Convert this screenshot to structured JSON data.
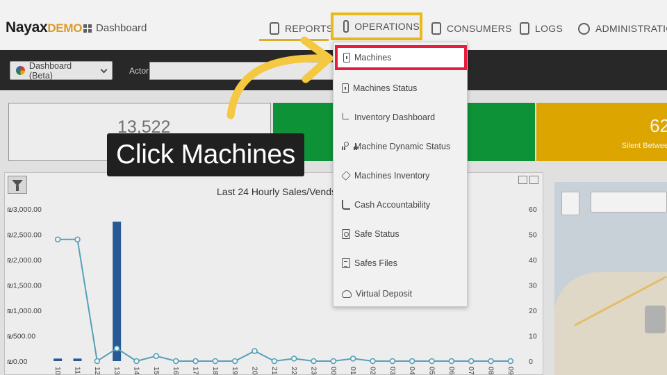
{
  "brand": {
    "name": "Nayax",
    "suffix": "DEMO"
  },
  "breadcrumb": {
    "label": "Dashboard"
  },
  "nav": {
    "reports": "REPORTS",
    "operations": "OPERATIONS",
    "consumers": "CONSUMERS",
    "logs": "LOGS",
    "administration": "ADMINISTRATION"
  },
  "toolbar": {
    "dashboard_select": "Dashboard (Beta)",
    "actor_label": "Actor",
    "actor_value": ""
  },
  "kpis": {
    "tile1_value": "13,522",
    "tile3_value": "62",
    "tile3_label": "Silent Betwee"
  },
  "operations_menu": {
    "items": [
      {
        "label": "Machines",
        "icon": "machine-icon"
      },
      {
        "label": "Machines Status",
        "icon": "machine-icon"
      },
      {
        "label": "Inventory Dashboard",
        "icon": "cart-icon"
      },
      {
        "label": "Machine Dynamic Status",
        "icon": "nodes-icon"
      },
      {
        "label": "Machines Inventory",
        "icon": "layers-icon"
      },
      {
        "label": "Cash Accountability",
        "icon": "hand-cash-icon"
      },
      {
        "label": "Safe Status",
        "icon": "safe-icon"
      },
      {
        "label": "Safes Files",
        "icon": "files-icon"
      },
      {
        "label": "Virtual Deposit",
        "icon": "cloud-upload-icon"
      }
    ]
  },
  "tutorial": {
    "callout": "Click Machines"
  },
  "colors": {
    "highlight_yellow": "#f6c21b",
    "highlight_red": "#e81c3f",
    "tile_green": "#0e9a3a",
    "tile_yellow": "#e8ae00",
    "bar_blue": "#2a5f9e",
    "line_teal": "#5aa9c4"
  },
  "chart_data": {
    "type": "bar",
    "title": "Last 24 Hourly Sales/Vends",
    "categories": [
      "10",
      "11",
      "12",
      "13",
      "14",
      "15",
      "16",
      "17",
      "18",
      "19",
      "20",
      "21",
      "22",
      "23",
      "00",
      "01",
      "02",
      "03",
      "04",
      "05",
      "06",
      "07",
      "08",
      "09"
    ],
    "y_left_ticks": [
      "₪3,000.00",
      "₪2,500.00",
      "₪2,000.00",
      "₪1,500.00",
      "₪1,000.00",
      "₪500.00",
      "₪0.00"
    ],
    "y_right_ticks": [
      "60",
      "50",
      "40",
      "30",
      "20",
      "10",
      "0"
    ],
    "ylim_left": [
      0,
      3000
    ],
    "ylim_right": [
      0,
      60
    ],
    "series": [
      {
        "values": [
          50,
          50,
          0,
          2750,
          0,
          0,
          0,
          0,
          0,
          0,
          0,
          0,
          0,
          0,
          0,
          0,
          0,
          0,
          0,
          0,
          0,
          0,
          0,
          0
        ]
      },
      {
        "values": [
          48,
          48,
          0,
          5,
          0,
          2,
          0,
          0,
          0,
          0,
          4,
          0,
          1,
          0,
          0,
          1,
          0,
          0,
          0,
          0,
          0,
          0,
          0,
          0
        ]
      }
    ],
    "grid": false
  }
}
